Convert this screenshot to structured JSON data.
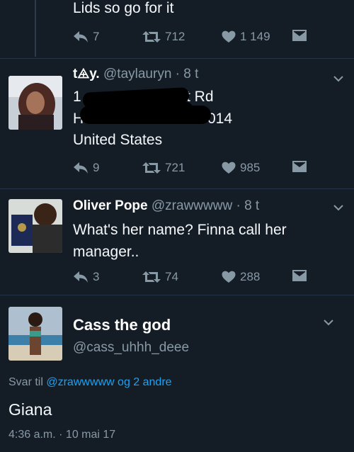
{
  "top_tweet": {
    "text_line": "Lids so go for it",
    "actions": {
      "replies": "7",
      "retweets": "712",
      "likes": "1 149"
    }
  },
  "tweet_tay": {
    "name": "t⨹y.",
    "handle": "@taylauryn",
    "time": "· 8 t",
    "line1_fragment_a": "1",
    "line1_fragment_b": "t Rd",
    "line2_fragment_a": "H",
    "line2_fragment_b": "014",
    "line3": "United States",
    "actions": {
      "replies": "9",
      "retweets": "721",
      "likes": "985"
    }
  },
  "tweet_oliver": {
    "name": "Oliver Pope",
    "handle": "@zrawwwww",
    "time": "· 8 t",
    "text": "What's her name? Finna call her manager..",
    "actions": {
      "replies": "3",
      "retweets": "74",
      "likes": "288"
    }
  },
  "tweet_cass": {
    "name": "Cass the god",
    "handle": "@cass_uhhh_deee",
    "reply_prefix": "Svar til",
    "reply_targets": "@zrawwwww og 2 andre",
    "text": "Giana",
    "timestamp": "4:36 a.m. · 10 mai 17"
  },
  "icons": {
    "reply": "reply-icon",
    "retweet": "retweet-icon",
    "like": "heart-icon",
    "dm": "envelope-icon",
    "more": "chevron-down-icon"
  },
  "colors": {
    "background": "#141d26",
    "muted": "#8899a6",
    "link": "#1da1f2"
  }
}
